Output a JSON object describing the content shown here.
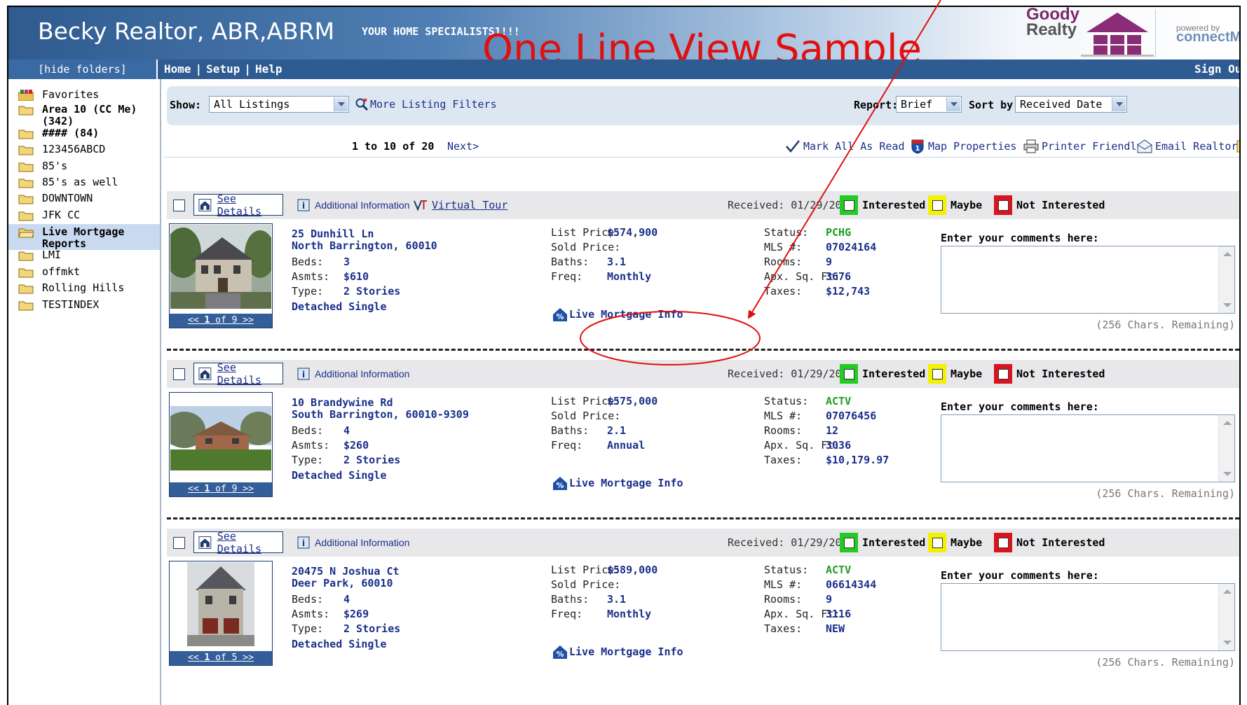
{
  "header": {
    "agent_name": "Becky Realtor, ABR,ABRM",
    "tagline": "YOUR HOME SPECIALISTS1!!!",
    "sample_title": "One Line View Sample",
    "brand_line1": "Goody",
    "brand_line2": "Realty",
    "powered_by": "powered by",
    "powered_brand": "connectMLS"
  },
  "nav": {
    "hide_folders": "[hide folders]",
    "home": "Home",
    "setup": "Setup",
    "help": "Help",
    "sep": "|",
    "sign_out": "Sign Out"
  },
  "sidebar": {
    "items": [
      {
        "label": "Favorites"
      },
      {
        "label": "Area 10 (CC Me)",
        "label2": "(342)"
      },
      {
        "label": "#### (84)"
      },
      {
        "label": "123456ABCD"
      },
      {
        "label": "85's"
      },
      {
        "label": "85's as well"
      },
      {
        "label": "DOWNTOWN"
      },
      {
        "label": "JFK CC"
      },
      {
        "label": "Live Mortgage",
        "label2": "Reports"
      },
      {
        "label": "LMI"
      },
      {
        "label": "offmkt"
      },
      {
        "label": "Rolling Hills"
      },
      {
        "label": "TESTINDEX"
      }
    ]
  },
  "filters": {
    "show_label": "Show:",
    "show_value": "All Listings",
    "more_filters": "More Listing Filters",
    "report_label": "Report:",
    "report_value": "Brief",
    "sort_label": "Sort by:",
    "sort_value": "Received Date"
  },
  "paging": {
    "range": "1 to 10 of 20",
    "next": "Next>",
    "mark_all_read": "Mark All As Read",
    "map_properties": "Map Properties",
    "printer_friendly": "Printer Friendly",
    "email_realtor": "Email Realtor"
  },
  "labels": {
    "see_details": "See Details",
    "additional_info": "Additional Information",
    "virtual_tour": "Virtual Tour",
    "interested": "Interested",
    "maybe": "Maybe",
    "not_interested": "Not Interested",
    "beds": "Beds:",
    "asmts": "Asmts:",
    "type": "Type:",
    "list_price": "List Price:",
    "sold_price": "Sold Price:",
    "baths": "Baths:",
    "freq": "Freq:",
    "status": "Status:",
    "mls": "MLS #:",
    "rooms": "Rooms:",
    "sqft": "Apx. Sq. Ft:",
    "taxes": "Taxes:",
    "live_mortgage": "Live Mortgage Info",
    "comments": "Enter your comments here:",
    "chars_remaining": "(256 Chars. Remaining)"
  },
  "colors": {
    "interested": "#22cc22",
    "maybe": "#f2f200",
    "not_interested": "#d8141c",
    "annotation": "#e11010"
  },
  "listings": [
    {
      "received": "Received: 01/29/2009",
      "street": "25 Dunhill Ln",
      "city": "North Barrington",
      "zip": ", 60010",
      "beds": "3",
      "asmts": "$610",
      "type": "2 Stories",
      "style": "Detached Single",
      "list_price": "$574,900",
      "sold_price": "",
      "baths": "3.1",
      "freq": "Monthly",
      "status": "PCHG",
      "mls": "07024164",
      "rooms": "9",
      "sqft": "3676",
      "taxes": "$12,743",
      "photo_page": "1",
      "photo_total": "9",
      "has_virtual_tour": true
    },
    {
      "received": "Received: 01/29/2009",
      "street": "10 Brandywine Rd",
      "city": "South Barrington",
      "zip": ", 60010-9309",
      "beds": "4",
      "asmts": "$260",
      "type": "2 Stories",
      "style": "Detached Single",
      "list_price": "$575,000",
      "sold_price": "",
      "baths": "2.1",
      "freq": "Annual",
      "status": "ACTV",
      "mls": "07076456",
      "rooms": "12",
      "sqft": "3036",
      "taxes": "$10,179.97",
      "photo_page": "1",
      "photo_total": "9",
      "has_virtual_tour": false
    },
    {
      "received": "Received: 01/29/2009",
      "street": "20475 N Joshua Ct",
      "city": "Deer Park",
      "zip": ", 60010",
      "beds": "4",
      "asmts": "$269",
      "type": "2 Stories",
      "style": "Detached Single",
      "list_price": "$589,000",
      "sold_price": "",
      "baths": "3.1",
      "freq": "Monthly",
      "status": "ACTV",
      "mls": "06614344",
      "rooms": "9",
      "sqft": "3116",
      "taxes": "NEW",
      "photo_page": "1",
      "photo_total": "5",
      "has_virtual_tour": false
    }
  ]
}
